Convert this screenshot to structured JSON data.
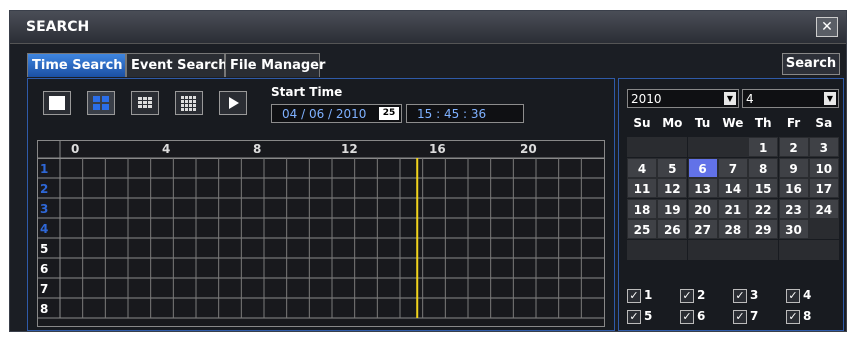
{
  "window": {
    "title": "SEARCH",
    "close_label": "✕"
  },
  "tabs": [
    {
      "label": "Time Search",
      "active": true
    },
    {
      "label": "Event Search",
      "active": false
    },
    {
      "label": "File Manager",
      "active": false
    }
  ],
  "search_button": {
    "label": "Search"
  },
  "view_buttons": [
    {
      "name": "single-view-button",
      "icon": "single-screen-icon"
    },
    {
      "name": "quad-view-button",
      "icon": "quad-screen-icon"
    },
    {
      "name": "nine-view-button",
      "icon": "nine-screen-icon"
    },
    {
      "name": "sixteen-view-button",
      "icon": "sixteen-screen-icon"
    },
    {
      "name": "play-button",
      "icon": "play-icon"
    }
  ],
  "start_time": {
    "label": "Start Time",
    "date": "04 / 06 / 2010",
    "date_icon": "25",
    "time": "15 :  45  :  36"
  },
  "timeline": {
    "hours": [
      "0",
      "4",
      "8",
      "12",
      "16",
      "20"
    ],
    "channels": [
      {
        "label": "1",
        "color": "#2e67d6"
      },
      {
        "label": "2",
        "color": "#2e67d6"
      },
      {
        "label": "3",
        "color": "#2e67d6"
      },
      {
        "label": "4",
        "color": "#2e67d6"
      },
      {
        "label": "5",
        "color": "#ffffff"
      },
      {
        "label": "6",
        "color": "#ffffff"
      },
      {
        "label": "7",
        "color": "#ffffff"
      },
      {
        "label": "8",
        "color": "#ffffff"
      }
    ],
    "cursor_hour": 15.76,
    "cursor_color": "#f2d41c"
  },
  "calendar": {
    "year": "2010",
    "month": "4",
    "weekdays": [
      "Su",
      "Mo",
      "Tu",
      "We",
      "Th",
      "Fr",
      "Sa"
    ],
    "days": [
      "",
      "",
      "",
      "",
      "1",
      "2",
      "3",
      "4",
      "5",
      "6",
      "7",
      "8",
      "9",
      "10",
      "11",
      "12",
      "13",
      "14",
      "15",
      "16",
      "17",
      "18",
      "19",
      "20",
      "21",
      "22",
      "23",
      "24",
      "25",
      "26",
      "27",
      "28",
      "29",
      "30",
      "",
      "",
      "",
      "",
      "",
      "",
      "",
      ""
    ],
    "selected_day": "6",
    "selected_color": "#6272e8"
  },
  "channel_checks": {
    "all_checked": true,
    "items": [
      "1",
      "2",
      "3",
      "4",
      "5",
      "6",
      "7",
      "8"
    ]
  }
}
